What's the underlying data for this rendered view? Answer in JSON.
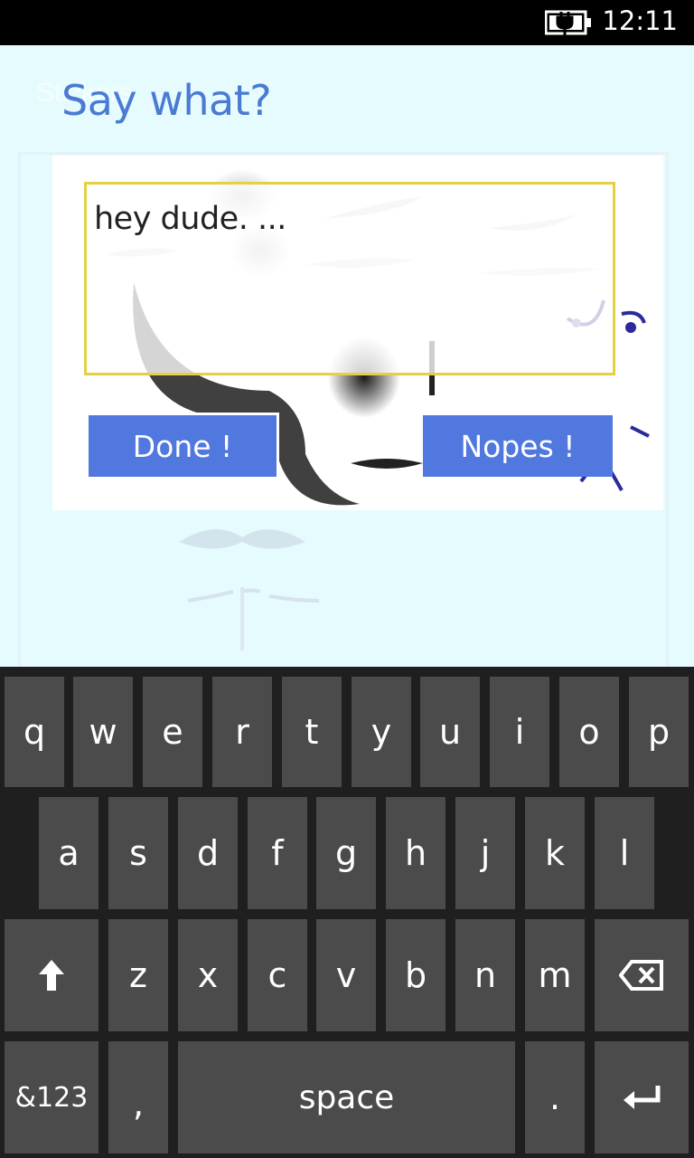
{
  "status_bar": {
    "time": "12:11",
    "battery_icon": "battery-charging-icon"
  },
  "background_title": "Stickers",
  "dialog": {
    "title": "Say what?",
    "input_text": "hey dude.  ...",
    "done_label": "Done !",
    "nopes_label": "Nopes !"
  },
  "keyboard": {
    "row1": [
      "q",
      "w",
      "e",
      "r",
      "t",
      "y",
      "u",
      "i",
      "o",
      "p"
    ],
    "row2": [
      "a",
      "s",
      "d",
      "f",
      "g",
      "h",
      "j",
      "k",
      "l"
    ],
    "row3": [
      "z",
      "x",
      "c",
      "v",
      "b",
      "n",
      "m"
    ],
    "shift_icon": "shift-arrow-icon",
    "backspace_icon": "backspace-icon",
    "symbols_label": "&123",
    "comma_label": ",",
    "space_label": "space",
    "period_label": ".",
    "enter_icon": "enter-icon"
  },
  "colors": {
    "accent": "#4a7ad4",
    "button": "#5178df",
    "textbox_border": "#e5d043",
    "keyboard_bg": "#1f1f1f",
    "key_bg": "#4b4b4b"
  }
}
